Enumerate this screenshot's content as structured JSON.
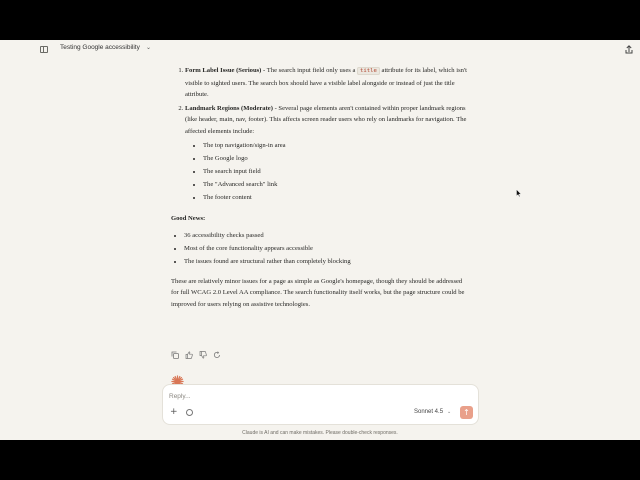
{
  "header": {
    "title": "Testing Google accessibility",
    "chevron": "⌄"
  },
  "message": {
    "items": [
      {
        "num": "1.",
        "heading": "Form Label Issue (Serious)",
        "pre": " - The search input field only uses a ",
        "code": "title",
        "post": " attribute for its label, which isn't visible to sighted users. The search box should have a visible label alongside or instead of just the title attribute."
      },
      {
        "num": "2.",
        "heading": "Landmark Regions (Moderate)",
        "pre": " - Several page elements aren't contained within proper landmark regions (like header, main, nav, footer). This affects screen reader users who rely on landmarks for navigation. The affected elements include:",
        "bullets": [
          "The top navigation/sign-in area",
          "The Google logo",
          "The search input field",
          "The \"Advanced search\" link",
          "The footer content"
        ]
      }
    ],
    "good_news_heading": "Good News:",
    "good_news": [
      "36 accessibility checks passed",
      "Most of the core functionality appears accessible",
      "The issues found are structural rather than completely blocking"
    ],
    "summary": "These are relatively minor issues for a page as simple as Google's homepage, though they should be addressed for full WCAG 2.0 Level AA compliance. The search functionality itself works, but the page structure could be improved for users relying on assistive technologies."
  },
  "actions": [
    "copy-icon",
    "thumbs-up-icon",
    "thumbs-down-icon",
    "retry-icon"
  ],
  "composer": {
    "placeholder": "Reply...",
    "plus": "+",
    "model": "Sonnet 4.5",
    "model_chevron": "⌄",
    "send": "↑"
  },
  "disclaimer": "Claude is AI and can make mistakes. Please double-check responses.",
  "colors": {
    "background": "#f5f3ee",
    "accent": "#e9a08a",
    "spark": "#d97757",
    "code": "#b0452f"
  }
}
